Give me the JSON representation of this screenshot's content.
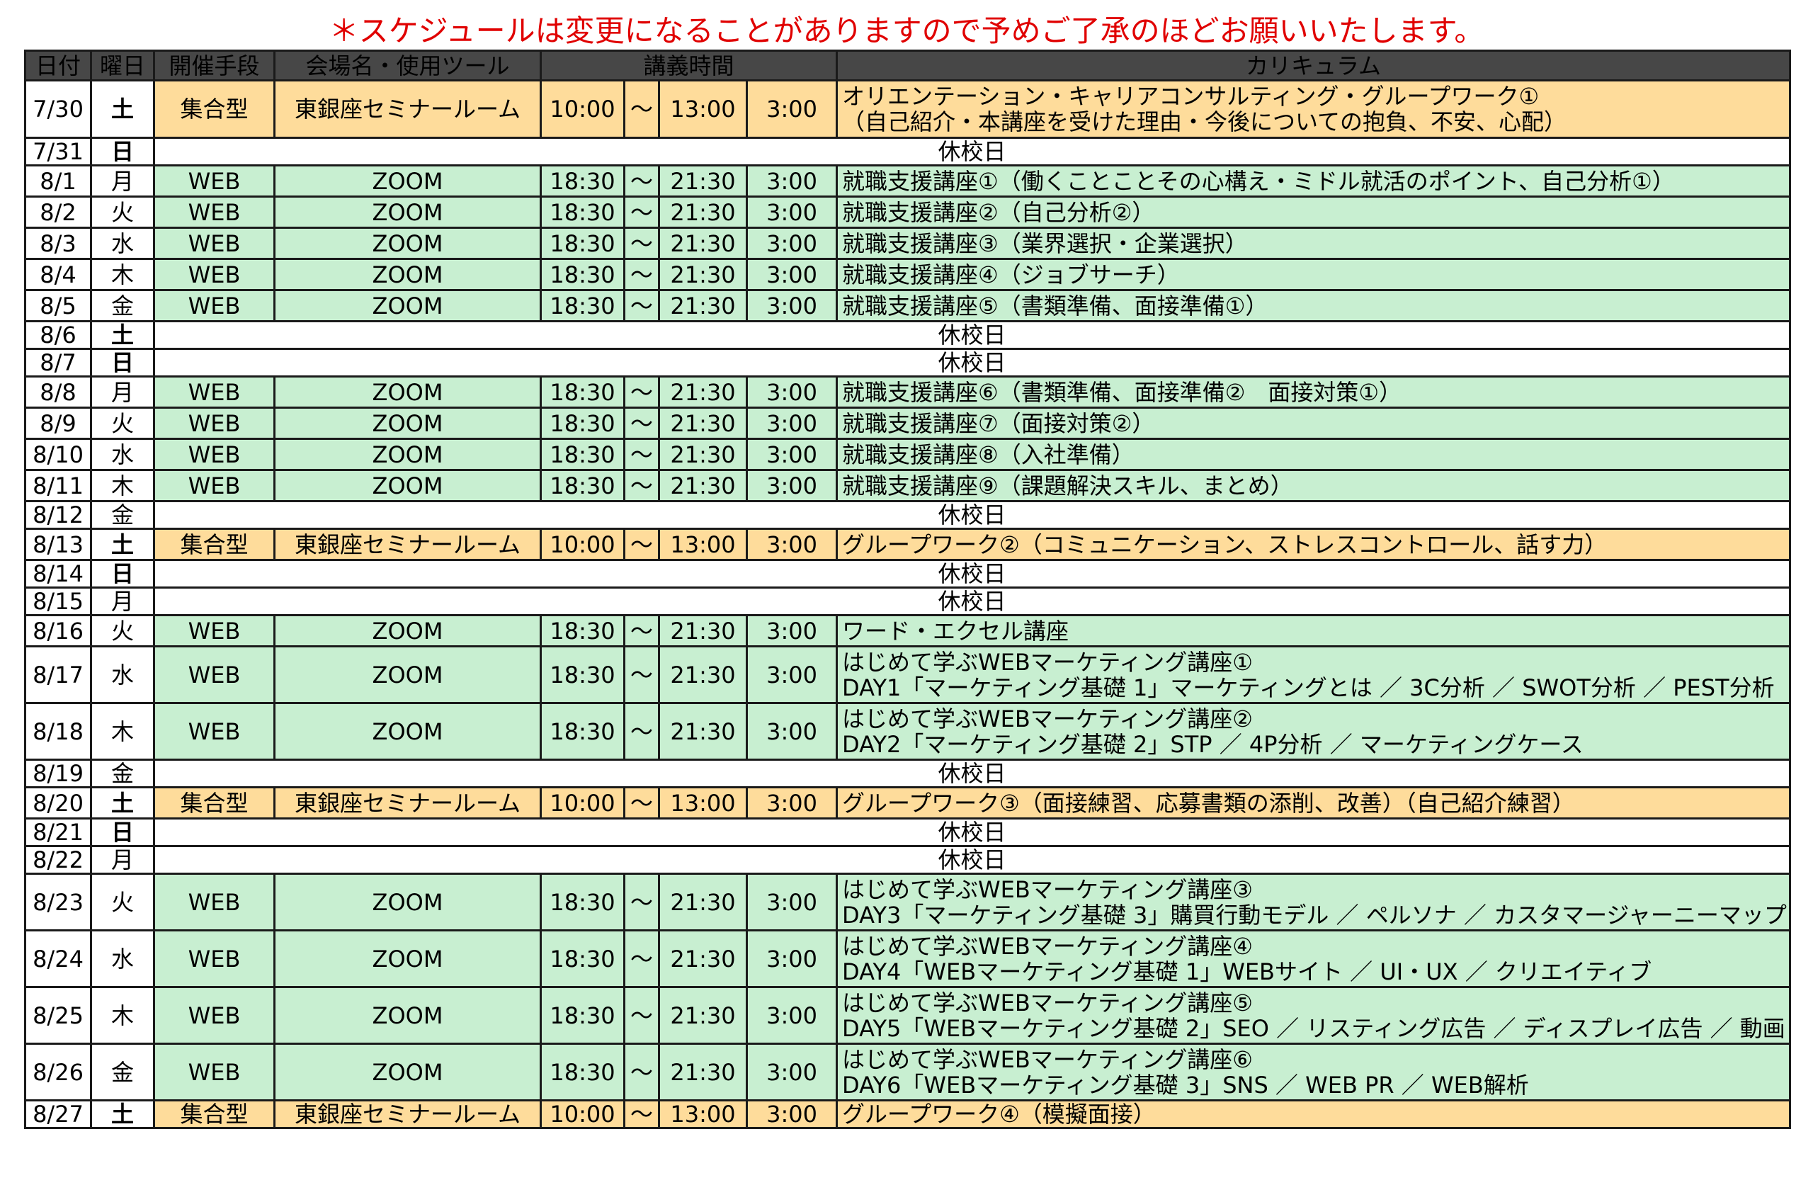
{
  "notice": "＊スケジュールは変更になることがありますので予めご了承のほどお願いいたします。",
  "headers": {
    "date": "日付",
    "day": "曜日",
    "method": "開催手段",
    "venue": "会場名・使用ツール",
    "time": "講義時間",
    "curriculum": "カリキュラム"
  },
  "colors": {
    "shugo_bg": "#fedc9b",
    "web_bg": "#c8efd1",
    "header_bg": "#474747",
    "saturday": "#1f3bd8",
    "sunday": "#e00000"
  },
  "rows": [
    {
      "date": "7/30",
      "day": "土",
      "method": "集合型",
      "venue": "東銀座セミナールーム",
      "start": "10:00",
      "sep": "～",
      "end": "13:00",
      "dur": "3:00",
      "curriculum": [
        "オリエンテーション・キャリアコンサルティング・グループワーク①",
        "（自己紹介・本講座を受けた理由・今後についての抱負、不安、心配）"
      ]
    },
    {
      "date": "7/31",
      "day": "日",
      "holiday": "休校日"
    },
    {
      "date": "8/1",
      "day": "月",
      "method": "WEB",
      "venue": "ZOOM",
      "start": "18:30",
      "sep": "～",
      "end": "21:30",
      "dur": "3:00",
      "curriculum": [
        "就職支援講座①（働くことことその心構え・ミドル就活のポイント、自己分析①）"
      ]
    },
    {
      "date": "8/2",
      "day": "火",
      "method": "WEB",
      "venue": "ZOOM",
      "start": "18:30",
      "sep": "～",
      "end": "21:30",
      "dur": "3:00",
      "curriculum": [
        "就職支援講座②（自己分析②）"
      ]
    },
    {
      "date": "8/3",
      "day": "水",
      "method": "WEB",
      "venue": "ZOOM",
      "start": "18:30",
      "sep": "～",
      "end": "21:30",
      "dur": "3:00",
      "curriculum": [
        "就職支援講座③（業界選択・企業選択）"
      ]
    },
    {
      "date": "8/4",
      "day": "木",
      "method": "WEB",
      "venue": "ZOOM",
      "start": "18:30",
      "sep": "～",
      "end": "21:30",
      "dur": "3:00",
      "curriculum": [
        "就職支援講座④（ジョブサーチ）"
      ]
    },
    {
      "date": "8/5",
      "day": "金",
      "method": "WEB",
      "venue": "ZOOM",
      "start": "18:30",
      "sep": "～",
      "end": "21:30",
      "dur": "3:00",
      "curriculum": [
        "就職支援講座⑤（書類準備、面接準備①）"
      ]
    },
    {
      "date": "8/6",
      "day": "土",
      "holiday": "休校日"
    },
    {
      "date": "8/7",
      "day": "日",
      "holiday": "休校日"
    },
    {
      "date": "8/8",
      "day": "月",
      "method": "WEB",
      "venue": "ZOOM",
      "start": "18:30",
      "sep": "～",
      "end": "21:30",
      "dur": "3:00",
      "curriculum": [
        "就職支援講座⑥（書類準備、面接準備②　面接対策①）"
      ]
    },
    {
      "date": "8/9",
      "day": "火",
      "method": "WEB",
      "venue": "ZOOM",
      "start": "18:30",
      "sep": "～",
      "end": "21:30",
      "dur": "3:00",
      "curriculum": [
        "就職支援講座⑦（面接対策②）"
      ]
    },
    {
      "date": "8/10",
      "day": "水",
      "method": "WEB",
      "venue": "ZOOM",
      "start": "18:30",
      "sep": "～",
      "end": "21:30",
      "dur": "3:00",
      "curriculum": [
        "就職支援講座⑧（入社準備）"
      ]
    },
    {
      "date": "8/11",
      "day": "木",
      "method": "WEB",
      "venue": "ZOOM",
      "start": "18:30",
      "sep": "～",
      "end": "21:30",
      "dur": "3:00",
      "curriculum": [
        "就職支援講座⑨（課題解決スキル、まとめ）"
      ]
    },
    {
      "date": "8/12",
      "day": "金",
      "holiday": "休校日"
    },
    {
      "date": "8/13",
      "day": "土",
      "method": "集合型",
      "venue": "東銀座セミナールーム",
      "start": "10:00",
      "sep": "～",
      "end": "13:00",
      "dur": "3:00",
      "curriculum": [
        "グループワーク②（コミュニケーション、ストレスコントロール、話す力）"
      ]
    },
    {
      "date": "8/14",
      "day": "日",
      "holiday": "休校日"
    },
    {
      "date": "8/15",
      "day": "月",
      "holiday": "休校日"
    },
    {
      "date": "8/16",
      "day": "火",
      "method": "WEB",
      "venue": "ZOOM",
      "start": "18:30",
      "sep": "～",
      "end": "21:30",
      "dur": "3:00",
      "curriculum": [
        "ワード・エクセル講座"
      ],
      "curriculum_color": "red"
    },
    {
      "date": "8/17",
      "day": "水",
      "method": "WEB",
      "venue": "ZOOM",
      "start": "18:30",
      "sep": "～",
      "end": "21:30",
      "dur": "3:00",
      "curriculum": [
        "はじめて学ぶWEBマーケティング講座①",
        "DAY1「マーケティング基礎 1」マーケティングとは ／ 3C分析 ／ SWOT分析 ／ PEST分析"
      ],
      "curriculum_color": "blue"
    },
    {
      "date": "8/18",
      "day": "木",
      "method": "WEB",
      "venue": "ZOOM",
      "start": "18:30",
      "sep": "～",
      "end": "21:30",
      "dur": "3:00",
      "curriculum": [
        "はじめて学ぶWEBマーケティング講座②",
        "DAY2「マーケティング基礎 2」STP ／ 4P分析 ／ マーケティングケース"
      ],
      "curriculum_color": "blue"
    },
    {
      "date": "8/19",
      "day": "金",
      "holiday": "休校日"
    },
    {
      "date": "8/20",
      "day": "土",
      "method": "集合型",
      "venue": "東銀座セミナールーム",
      "start": "10:00",
      "sep": "～",
      "end": "13:00",
      "dur": "3:00",
      "curriculum": [
        "グループワーク③（面接練習、応募書類の添削、改善）（自己紹介練習）"
      ]
    },
    {
      "date": "8/21",
      "day": "日",
      "holiday": "休校日"
    },
    {
      "date": "8/22",
      "day": "月",
      "holiday": "休校日"
    },
    {
      "date": "8/23",
      "day": "火",
      "method": "WEB",
      "venue": "ZOOM",
      "start": "18:30",
      "sep": "～",
      "end": "21:30",
      "dur": "3:00",
      "curriculum": [
        "はじめて学ぶWEBマーケティング講座③",
        "DAY3「マーケティング基礎 3」購買行動モデル ／ ペルソナ ／ カスタマージャーニーマップ"
      ],
      "curriculum_color": "blue"
    },
    {
      "date": "8/24",
      "day": "水",
      "method": "WEB",
      "venue": "ZOOM",
      "start": "18:30",
      "sep": "～",
      "end": "21:30",
      "dur": "3:00",
      "curriculum": [
        "はじめて学ぶWEBマーケティング講座④",
        "DAY4「WEBマーケティング基礎 1」WEBサイト ／ UI・UX ／ クリエイティブ"
      ],
      "curriculum_color": "blue"
    },
    {
      "date": "8/25",
      "day": "木",
      "method": "WEB",
      "venue": "ZOOM",
      "start": "18:30",
      "sep": "～",
      "end": "21:30",
      "dur": "3:00",
      "curriculum": [
        "はじめて学ぶWEBマーケティング講座⑤",
        "DAY5「WEBマーケティング基礎 2」SEO ／ リスティング広告 ／ ディスプレイ広告 ／ 動画"
      ],
      "curriculum_color": "blue"
    },
    {
      "date": "8/26",
      "day": "金",
      "method": "WEB",
      "venue": "ZOOM",
      "start": "18:30",
      "sep": "～",
      "end": "21:30",
      "dur": "3:00",
      "curriculum": [
        "はじめて学ぶWEBマーケティング講座⑥",
        "DAY6「WEBマーケティング基礎 3」SNS ／ WEB PR ／ WEB解析"
      ],
      "curriculum_color": "blue"
    },
    {
      "date": "8/27",
      "day": "土",
      "method": "集合型",
      "venue": "東銀座セミナールーム",
      "start": "10:00",
      "sep": "～",
      "end": "13:00",
      "dur": "3:00",
      "curriculum": [
        "グループワーク④（模擬面接）"
      ]
    }
  ]
}
